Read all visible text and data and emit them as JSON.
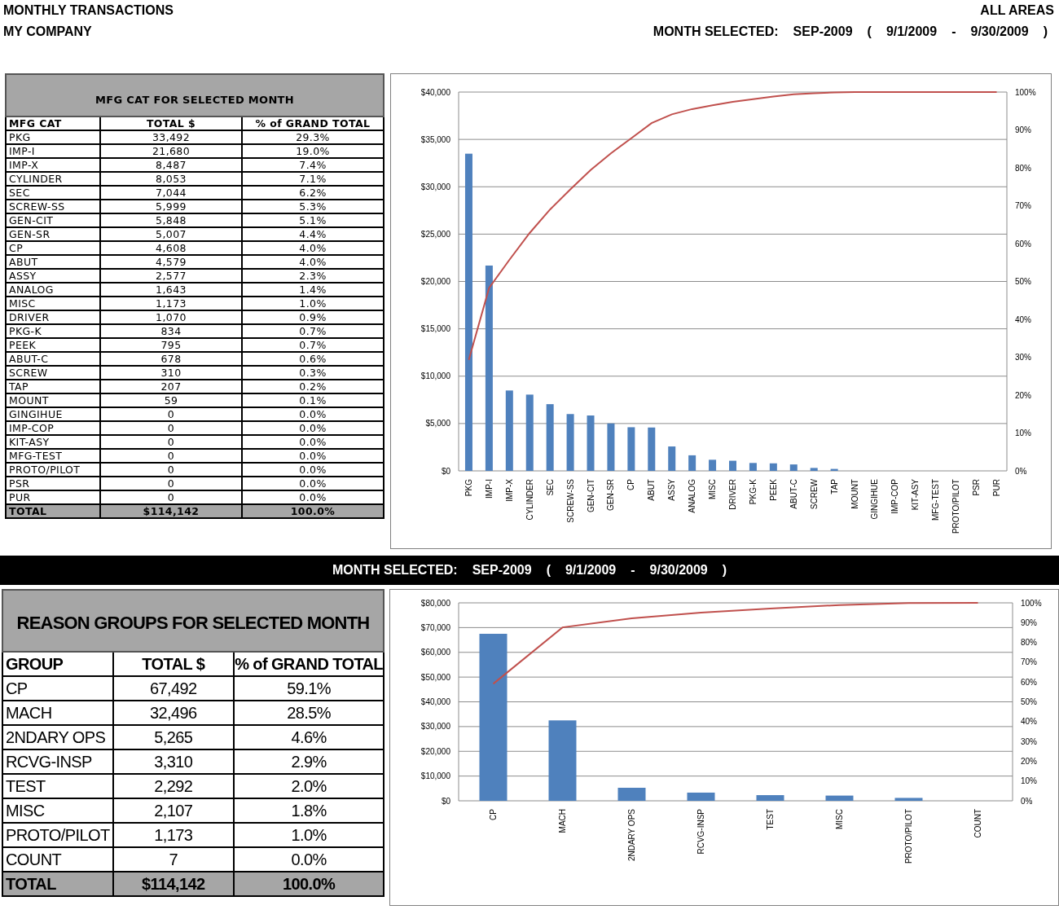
{
  "header": {
    "title": "MONTHLY TRANSACTIONS",
    "company": "MY COMPANY",
    "area": "ALL AREAS",
    "month_parts": [
      "MONTH SELECTED:",
      "SEP-2009",
      "(",
      "9/1/2009",
      "-",
      "9/30/2009",
      ")"
    ]
  },
  "mfg_table": {
    "title": "MFG CAT FOR SELECTED MONTH",
    "columns": [
      "MFG CAT",
      "TOTAL $",
      "% of GRAND TOTAL"
    ],
    "rows": [
      [
        "PKG",
        "33,492",
        "29.3%"
      ],
      [
        "IMP-I",
        "21,680",
        "19.0%"
      ],
      [
        "IMP-X",
        "8,487",
        "7.4%"
      ],
      [
        "CYLINDER",
        "8,053",
        "7.1%"
      ],
      [
        "SEC",
        "7,044",
        "6.2%"
      ],
      [
        "SCREW-SS",
        "5,999",
        "5.3%"
      ],
      [
        "GEN-CIT",
        "5,848",
        "5.1%"
      ],
      [
        "GEN-SR",
        "5,007",
        "4.4%"
      ],
      [
        "CP",
        "4,608",
        "4.0%"
      ],
      [
        "ABUT",
        "4,579",
        "4.0%"
      ],
      [
        "ASSY",
        "2,577",
        "2.3%"
      ],
      [
        "ANALOG",
        "1,643",
        "1.4%"
      ],
      [
        "MISC",
        "1,173",
        "1.0%"
      ],
      [
        "DRIVER",
        "1,070",
        "0.9%"
      ],
      [
        "PKG-K",
        "834",
        "0.7%"
      ],
      [
        "PEEK",
        "795",
        "0.7%"
      ],
      [
        "ABUT-C",
        "678",
        "0.6%"
      ],
      [
        "SCREW",
        "310",
        "0.3%"
      ],
      [
        "TAP",
        "207",
        "0.2%"
      ],
      [
        "MOUNT",
        "59",
        "0.1%"
      ],
      [
        "GINGIHUE",
        "0",
        "0.0%"
      ],
      [
        "IMP-COP",
        "0",
        "0.0%"
      ],
      [
        "KIT-ASY",
        "0",
        "0.0%"
      ],
      [
        "MFG-TEST",
        "0",
        "0.0%"
      ],
      [
        "PROTO/PILOT",
        "0",
        "0.0%"
      ],
      [
        "PSR",
        "0",
        "0.0%"
      ],
      [
        "PUR",
        "0",
        "0.0%"
      ]
    ],
    "total": [
      "TOTAL",
      "$114,142",
      "100.0%"
    ]
  },
  "mfg_chart": {
    "chart_data": {
      "type": "bar",
      "categories": [
        "PKG",
        "IMP-I",
        "IMP-X",
        "CYLINDER",
        "SEC",
        "SCREW-SS",
        "GEN-CIT",
        "GEN-SR",
        "CP",
        "ABUT",
        "ASSY",
        "ANALOG",
        "MISC",
        "DRIVER",
        "PKG-K",
        "PEEK",
        "ABUT-C",
        "SCREW",
        "TAP",
        "MOUNT",
        "GINGIHUE",
        "IMP-COP",
        "KIT-ASY",
        "MFG-TEST",
        "PROTO/PILOT",
        "PSR",
        "PUR"
      ],
      "grid": true,
      "y2lim": [
        0,
        100
      ],
      "series": [
        {
          "type": "bar",
          "axis": "y",
          "color": "#4f81bd",
          "values": [
            33492,
            21680,
            8487,
            8053,
            7044,
            5999,
            5848,
            5007,
            4608,
            4579,
            2577,
            1643,
            1173,
            1070,
            834,
            795,
            678,
            310,
            207,
            59,
            0,
            0,
            0,
            0,
            0,
            0,
            0
          ]
        },
        {
          "type": "line",
          "axis": "y2",
          "color": "#c0504d",
          "values": [
            29.3,
            48.3,
            55.7,
            62.8,
            69.0,
            74.3,
            79.4,
            83.8,
            87.8,
            91.8,
            94.1,
            95.5,
            96.5,
            97.4,
            98.1,
            98.8,
            99.4,
            99.7,
            99.9,
            100,
            100,
            100,
            100,
            100,
            100,
            100,
            100
          ]
        }
      ],
      "ylim": [
        0,
        40000
      ],
      "yticks": [
        {
          "value": 0,
          "label": "$0"
        },
        {
          "value": 5000,
          "label": "$5,000"
        },
        {
          "value": 10000,
          "label": "$10,000"
        },
        {
          "value": 15000,
          "label": "$15,000"
        },
        {
          "value": 20000,
          "label": "$20,000"
        },
        {
          "value": 25000,
          "label": "$25,000"
        },
        {
          "value": 30000,
          "label": "$30,000"
        },
        {
          "value": 35000,
          "label": "$35,000"
        },
        {
          "value": 40000,
          "label": "$40,000"
        }
      ],
      "y2ticks": [
        {
          "value": 0,
          "label": "0%"
        },
        {
          "value": 10,
          "label": "10%"
        },
        {
          "value": 20,
          "label": "20%"
        },
        {
          "value": 30,
          "label": "30%"
        },
        {
          "value": 40,
          "label": "40%"
        },
        {
          "value": 50,
          "label": "50%"
        },
        {
          "value": 60,
          "label": "60%"
        },
        {
          "value": 70,
          "label": "70%"
        },
        {
          "value": 80,
          "label": "80%"
        },
        {
          "value": 90,
          "label": "90%"
        },
        {
          "value": 100,
          "label": "100%"
        }
      ]
    }
  },
  "band": {
    "month_parts": [
      "MONTH SELECTED:",
      "SEP-2009",
      "(",
      "9/1/2009",
      "-",
      "9/30/2009",
      ")"
    ]
  },
  "reason_table": {
    "title": "REASON GROUPS FOR SELECTED MONTH",
    "columns": [
      "GROUP",
      "TOTAL $",
      "% of GRAND TOTAL"
    ],
    "rows": [
      [
        "CP",
        "67,492",
        "59.1%"
      ],
      [
        "MACH",
        "32,496",
        "28.5%"
      ],
      [
        "2NDARY OPS",
        "5,265",
        "4.6%"
      ],
      [
        "RCVG-INSP",
        "3,310",
        "2.9%"
      ],
      [
        "TEST",
        "2,292",
        "2.0%"
      ],
      [
        "MISC",
        "2,107",
        "1.8%"
      ],
      [
        "PROTO/PILOT",
        "1,173",
        "1.0%"
      ],
      [
        "COUNT",
        "7",
        "0.0%"
      ]
    ],
    "total": [
      "TOTAL",
      "$114,142",
      "100.0%"
    ]
  },
  "reason_chart": {
    "chart_data": {
      "type": "bar",
      "categories": [
        "CP",
        "MACH",
        "2NDARY OPS",
        "RCVG-INSP",
        "TEST",
        "MISC",
        "PROTO/PILOT",
        "COUNT"
      ],
      "grid": true,
      "y2lim": [
        0,
        100
      ],
      "series": [
        {
          "type": "bar",
          "axis": "y",
          "color": "#4f81bd",
          "values": [
            67492,
            32496,
            5265,
            3310,
            2292,
            2107,
            1173,
            7
          ]
        },
        {
          "type": "line",
          "axis": "y2",
          "color": "#c0504d",
          "values": [
            59.1,
            87.6,
            92.2,
            95.1,
            97.1,
            98.9,
            99.9,
            100
          ]
        }
      ],
      "ylim": [
        0,
        80000
      ],
      "yticks": [
        {
          "value": 0,
          "label": "$0"
        },
        {
          "value": 10000,
          "label": "$10,000"
        },
        {
          "value": 20000,
          "label": "$20,000"
        },
        {
          "value": 30000,
          "label": "$30,000"
        },
        {
          "value": 40000,
          "label": "$40,000"
        },
        {
          "value": 50000,
          "label": "$50,000"
        },
        {
          "value": 60000,
          "label": "$60,000"
        },
        {
          "value": 70000,
          "label": "$70,000"
        },
        {
          "value": 80000,
          "label": "$80,000"
        }
      ],
      "y2ticks": [
        {
          "value": 0,
          "label": "0%"
        },
        {
          "value": 10,
          "label": "10%"
        },
        {
          "value": 20,
          "label": "20%"
        },
        {
          "value": 30,
          "label": "30%"
        },
        {
          "value": 40,
          "label": "40%"
        },
        {
          "value": 50,
          "label": "50%"
        },
        {
          "value": 60,
          "label": "60%"
        },
        {
          "value": 70,
          "label": "70%"
        },
        {
          "value": 80,
          "label": "80%"
        },
        {
          "value": 90,
          "label": "90%"
        },
        {
          "value": 100,
          "label": "100%"
        }
      ]
    }
  }
}
